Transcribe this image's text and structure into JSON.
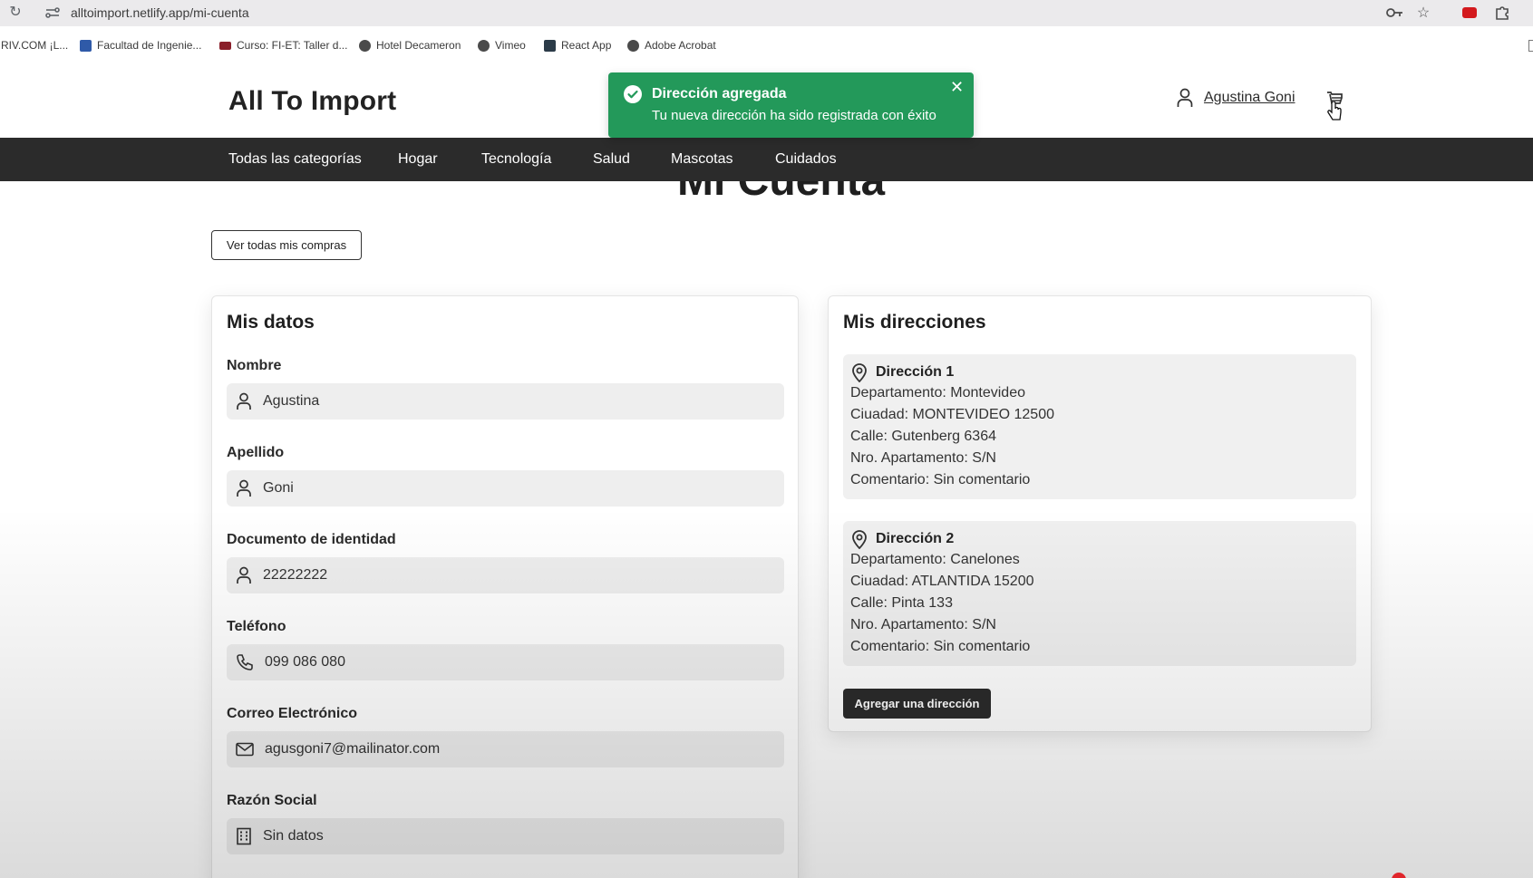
{
  "browser": {
    "url": "alltoimport.netlify.app/mi-cuenta",
    "bookmarks": [
      "RIV.COM ¡L...",
      "Facultad de Ingenie...",
      "Curso: FI-ET: Taller d...",
      "Hotel Decameron",
      "Vimeo",
      "React App",
      "Adobe Acrobat"
    ]
  },
  "header": {
    "brand": "All To Import",
    "user_name": "Agustina Goni"
  },
  "nav": {
    "items": [
      "Todas las categorías",
      "Hogar",
      "Tecnología",
      "Salud",
      "Mascotas",
      "Cuidados"
    ]
  },
  "toast": {
    "title": "Dirección agregada",
    "message": "Tu nueva dirección ha sido registrada con éxito",
    "color": "#23995a"
  },
  "page": {
    "title": "Mi Cuenta",
    "view_purchases": "Ver todas mis compras"
  },
  "mis_datos": {
    "title": "Mis datos",
    "fields": [
      {
        "label": "Nombre",
        "value": "Agustina",
        "icon": "user-icon"
      },
      {
        "label": "Apellido",
        "value": "Goni",
        "icon": "user-icon"
      },
      {
        "label": "Documento de identidad",
        "value": "22222222",
        "icon": "user-icon"
      },
      {
        "label": "Teléfono",
        "value": "099 086 080",
        "icon": "phone-icon"
      },
      {
        "label": "Correo Electrónico",
        "value": "agusgoni7@mailinator.com",
        "icon": "mail-icon"
      },
      {
        "label": "Razón Social",
        "value": "Sin datos",
        "icon": "building-icon"
      }
    ]
  },
  "mis_direcciones": {
    "title": "Mis direcciones",
    "addresses": [
      {
        "name": "Dirección 1",
        "departamento": "Departamento: Montevideo",
        "ciudad": "Ciuadad: MONTEVIDEO 12500",
        "calle": "Calle: Gutenberg 6364",
        "apartamento": "Nro. Apartamento: S/N",
        "comentario": "Comentario: Sin comentario"
      },
      {
        "name": "Dirección 2",
        "departamento": "Departamento: Canelones",
        "ciudad": "Ciuadad: ATLANTIDA 15200",
        "calle": "Calle: Pinta 133",
        "apartamento": "Nro. Apartamento: S/N",
        "comentario": "Comentario: Sin comentario"
      }
    ],
    "add_button": "Agregar una dirección"
  }
}
